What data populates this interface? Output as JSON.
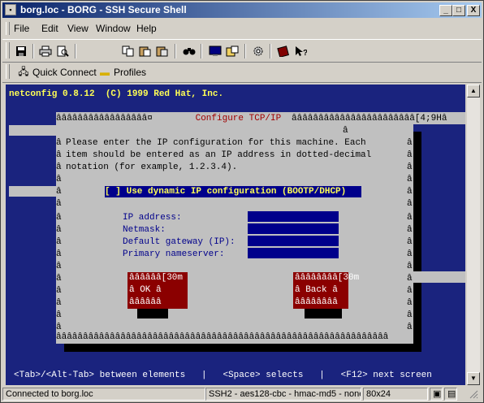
{
  "window": {
    "title": "borg.loc - BORG - SSH Secure Shell",
    "minimize": "_",
    "maximize": "□",
    "close": "X"
  },
  "menu": [
    "File",
    "Edit",
    "View",
    "Window",
    "Help"
  ],
  "toolbar_icons": [
    "save-icon",
    "print-icon",
    "print-preview-icon",
    "copy-icon",
    "paste-icon",
    "paste-special-icon",
    "find-icon",
    "new-terminal-icon",
    "new-file-transfer-icon",
    "settings-icon",
    "help-book-icon",
    "whats-this-icon"
  ],
  "profiles_bar": {
    "quick_connect": "Quick Connect",
    "profiles": "Profiles"
  },
  "terminal": {
    "header": "netconfig 0.8.12  (C) 1999 Red Hat, Inc.",
    "dialog_title_left": "âââââââââââââââââ¤",
    "dialog_title": " Configure TCP/IP ",
    "dialog_title_right": "âââââââââââââââââââââââ[4;9Hâ",
    "lines": [
      "Please enter the IP configuration for this machine. Each",
      "item should be entered as an IP address in dotted-decimal",
      "notation (for example, 1.2.3.4)."
    ],
    "checkbox_mark": "[ ]",
    "checkbox_label": " Use dynamic IP configuration (BOOTP/DHCP)",
    "fields": [
      "IP address:",
      "Netmask:",
      "Default gateway (IP):",
      "Primary nameserver:"
    ],
    "ok_button": [
      "ââââââ[30m",
      "â OK â",
      "ââââââ"
    ],
    "back_button": [
      "ââââââââ[30m",
      "â Back â",
      "ââââââââ"
    ],
    "border_char": "â",
    "bottom_border": "ââââââââââââââââââââââââââââââââââââââââââââââââââââââââââââââ",
    "status_line": "<Tab>/<Alt-Tab> between elements   |   <Space> selects   |   <F12> next screen"
  },
  "status": {
    "connection": "Connected to borg.loc",
    "cipher": "SSH2 - aes128-cbc - hmac-md5 - none",
    "size": "80x24"
  }
}
